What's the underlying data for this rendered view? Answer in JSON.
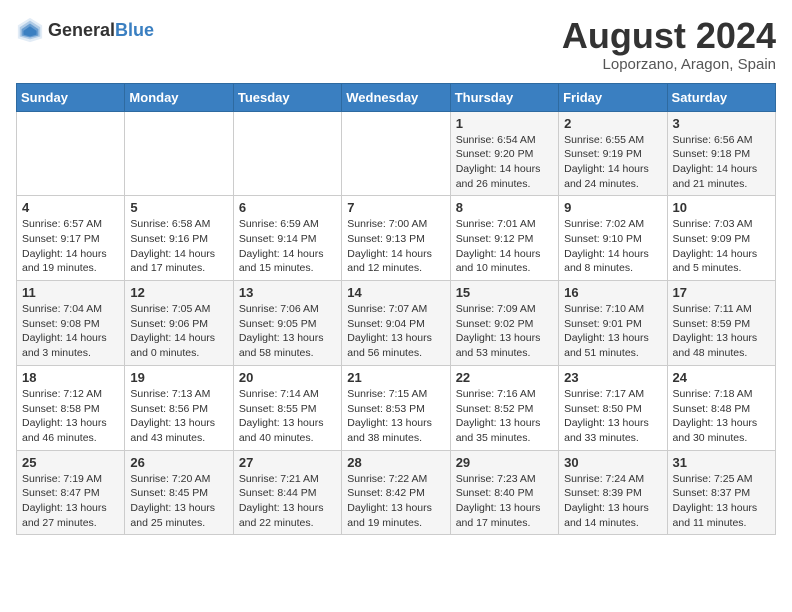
{
  "header": {
    "logo_general": "General",
    "logo_blue": "Blue",
    "title": "August 2024",
    "subtitle": "Loporzano, Aragon, Spain"
  },
  "calendar": {
    "days_of_week": [
      "Sunday",
      "Monday",
      "Tuesday",
      "Wednesday",
      "Thursday",
      "Friday",
      "Saturday"
    ],
    "weeks": [
      [
        {
          "day": "",
          "info": ""
        },
        {
          "day": "",
          "info": ""
        },
        {
          "day": "",
          "info": ""
        },
        {
          "day": "",
          "info": ""
        },
        {
          "day": "1",
          "info": "Sunrise: 6:54 AM\nSunset: 9:20 PM\nDaylight: 14 hours\nand 26 minutes."
        },
        {
          "day": "2",
          "info": "Sunrise: 6:55 AM\nSunset: 9:19 PM\nDaylight: 14 hours\nand 24 minutes."
        },
        {
          "day": "3",
          "info": "Sunrise: 6:56 AM\nSunset: 9:18 PM\nDaylight: 14 hours\nand 21 minutes."
        }
      ],
      [
        {
          "day": "4",
          "info": "Sunrise: 6:57 AM\nSunset: 9:17 PM\nDaylight: 14 hours\nand 19 minutes."
        },
        {
          "day": "5",
          "info": "Sunrise: 6:58 AM\nSunset: 9:16 PM\nDaylight: 14 hours\nand 17 minutes."
        },
        {
          "day": "6",
          "info": "Sunrise: 6:59 AM\nSunset: 9:14 PM\nDaylight: 14 hours\nand 15 minutes."
        },
        {
          "day": "7",
          "info": "Sunrise: 7:00 AM\nSunset: 9:13 PM\nDaylight: 14 hours\nand 12 minutes."
        },
        {
          "day": "8",
          "info": "Sunrise: 7:01 AM\nSunset: 9:12 PM\nDaylight: 14 hours\nand 10 minutes."
        },
        {
          "day": "9",
          "info": "Sunrise: 7:02 AM\nSunset: 9:10 PM\nDaylight: 14 hours\nand 8 minutes."
        },
        {
          "day": "10",
          "info": "Sunrise: 7:03 AM\nSunset: 9:09 PM\nDaylight: 14 hours\nand 5 minutes."
        }
      ],
      [
        {
          "day": "11",
          "info": "Sunrise: 7:04 AM\nSunset: 9:08 PM\nDaylight: 14 hours\nand 3 minutes."
        },
        {
          "day": "12",
          "info": "Sunrise: 7:05 AM\nSunset: 9:06 PM\nDaylight: 14 hours\nand 0 minutes."
        },
        {
          "day": "13",
          "info": "Sunrise: 7:06 AM\nSunset: 9:05 PM\nDaylight: 13 hours\nand 58 minutes."
        },
        {
          "day": "14",
          "info": "Sunrise: 7:07 AM\nSunset: 9:04 PM\nDaylight: 13 hours\nand 56 minutes."
        },
        {
          "day": "15",
          "info": "Sunrise: 7:09 AM\nSunset: 9:02 PM\nDaylight: 13 hours\nand 53 minutes."
        },
        {
          "day": "16",
          "info": "Sunrise: 7:10 AM\nSunset: 9:01 PM\nDaylight: 13 hours\nand 51 minutes."
        },
        {
          "day": "17",
          "info": "Sunrise: 7:11 AM\nSunset: 8:59 PM\nDaylight: 13 hours\nand 48 minutes."
        }
      ],
      [
        {
          "day": "18",
          "info": "Sunrise: 7:12 AM\nSunset: 8:58 PM\nDaylight: 13 hours\nand 46 minutes."
        },
        {
          "day": "19",
          "info": "Sunrise: 7:13 AM\nSunset: 8:56 PM\nDaylight: 13 hours\nand 43 minutes."
        },
        {
          "day": "20",
          "info": "Sunrise: 7:14 AM\nSunset: 8:55 PM\nDaylight: 13 hours\nand 40 minutes."
        },
        {
          "day": "21",
          "info": "Sunrise: 7:15 AM\nSunset: 8:53 PM\nDaylight: 13 hours\nand 38 minutes."
        },
        {
          "day": "22",
          "info": "Sunrise: 7:16 AM\nSunset: 8:52 PM\nDaylight: 13 hours\nand 35 minutes."
        },
        {
          "day": "23",
          "info": "Sunrise: 7:17 AM\nSunset: 8:50 PM\nDaylight: 13 hours\nand 33 minutes."
        },
        {
          "day": "24",
          "info": "Sunrise: 7:18 AM\nSunset: 8:48 PM\nDaylight: 13 hours\nand 30 minutes."
        }
      ],
      [
        {
          "day": "25",
          "info": "Sunrise: 7:19 AM\nSunset: 8:47 PM\nDaylight: 13 hours\nand 27 minutes."
        },
        {
          "day": "26",
          "info": "Sunrise: 7:20 AM\nSunset: 8:45 PM\nDaylight: 13 hours\nand 25 minutes."
        },
        {
          "day": "27",
          "info": "Sunrise: 7:21 AM\nSunset: 8:44 PM\nDaylight: 13 hours\nand 22 minutes."
        },
        {
          "day": "28",
          "info": "Sunrise: 7:22 AM\nSunset: 8:42 PM\nDaylight: 13 hours\nand 19 minutes."
        },
        {
          "day": "29",
          "info": "Sunrise: 7:23 AM\nSunset: 8:40 PM\nDaylight: 13 hours\nand 17 minutes."
        },
        {
          "day": "30",
          "info": "Sunrise: 7:24 AM\nSunset: 8:39 PM\nDaylight: 13 hours\nand 14 minutes."
        },
        {
          "day": "31",
          "info": "Sunrise: 7:25 AM\nSunset: 8:37 PM\nDaylight: 13 hours\nand 11 minutes."
        }
      ]
    ]
  }
}
